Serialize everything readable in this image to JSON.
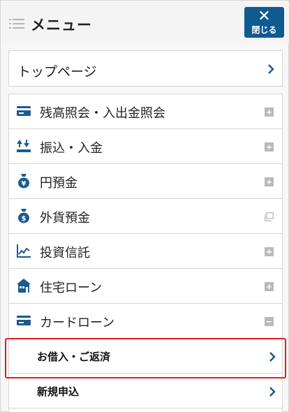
{
  "header": {
    "title": "メニュー",
    "menu_icon": "list-icon",
    "close_icon": "close-icon",
    "close_label": "閉じる",
    "close_bg": "#0f5a8f"
  },
  "top_page": {
    "label": "トップページ"
  },
  "menu_items": [
    {
      "label": "残高照会・入出金照会",
      "icon": "card-icon",
      "toggle": "plus"
    },
    {
      "label": "振込・入金",
      "icon": "transfer-icon",
      "toggle": "plus"
    },
    {
      "label": "円預金",
      "icon": "yen-bag-icon",
      "toggle": "plus"
    },
    {
      "label": "外貨預金",
      "icon": "dollar-bag-icon",
      "toggle": "window"
    },
    {
      "label": "投資信託",
      "icon": "chart-icon",
      "toggle": "plus"
    },
    {
      "label": "住宅ローン",
      "icon": "house-icon",
      "toggle": "plus"
    },
    {
      "label": "カードローン",
      "icon": "card-icon",
      "toggle": "minus"
    }
  ],
  "sub_items": [
    {
      "label": "お借入・ご返済",
      "highlighted": true
    },
    {
      "label": "新規申込",
      "highlighted": false
    }
  ],
  "colors": {
    "accent": "#0f5a8f",
    "icon_blue": "#1c5a8e",
    "highlight": "#e0201e",
    "toggle_gray": "#b9b9b9"
  }
}
